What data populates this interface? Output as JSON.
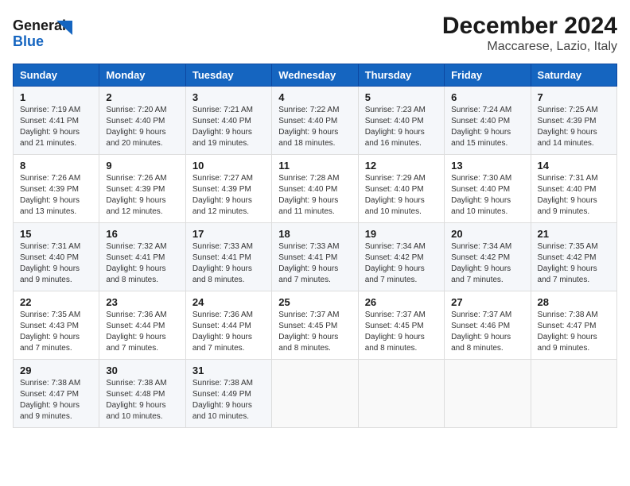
{
  "header": {
    "logo_line1": "General",
    "logo_line2": "Blue",
    "title": "December 2024",
    "subtitle": "Maccarese, Lazio, Italy"
  },
  "days_of_week": [
    "Sunday",
    "Monday",
    "Tuesday",
    "Wednesday",
    "Thursday",
    "Friday",
    "Saturday"
  ],
  "weeks": [
    [
      {
        "day": "1",
        "lines": [
          "Sunrise: 7:19 AM",
          "Sunset: 4:41 PM",
          "Daylight: 9 hours",
          "and 21 minutes."
        ]
      },
      {
        "day": "2",
        "lines": [
          "Sunrise: 7:20 AM",
          "Sunset: 4:40 PM",
          "Daylight: 9 hours",
          "and 20 minutes."
        ]
      },
      {
        "day": "3",
        "lines": [
          "Sunrise: 7:21 AM",
          "Sunset: 4:40 PM",
          "Daylight: 9 hours",
          "and 19 minutes."
        ]
      },
      {
        "day": "4",
        "lines": [
          "Sunrise: 7:22 AM",
          "Sunset: 4:40 PM",
          "Daylight: 9 hours",
          "and 18 minutes."
        ]
      },
      {
        "day": "5",
        "lines": [
          "Sunrise: 7:23 AM",
          "Sunset: 4:40 PM",
          "Daylight: 9 hours",
          "and 16 minutes."
        ]
      },
      {
        "day": "6",
        "lines": [
          "Sunrise: 7:24 AM",
          "Sunset: 4:40 PM",
          "Daylight: 9 hours",
          "and 15 minutes."
        ]
      },
      {
        "day": "7",
        "lines": [
          "Sunrise: 7:25 AM",
          "Sunset: 4:39 PM",
          "Daylight: 9 hours",
          "and 14 minutes."
        ]
      }
    ],
    [
      {
        "day": "8",
        "lines": [
          "Sunrise: 7:26 AM",
          "Sunset: 4:39 PM",
          "Daylight: 9 hours",
          "and 13 minutes."
        ]
      },
      {
        "day": "9",
        "lines": [
          "Sunrise: 7:26 AM",
          "Sunset: 4:39 PM",
          "Daylight: 9 hours",
          "and 12 minutes."
        ]
      },
      {
        "day": "10",
        "lines": [
          "Sunrise: 7:27 AM",
          "Sunset: 4:39 PM",
          "Daylight: 9 hours",
          "and 12 minutes."
        ]
      },
      {
        "day": "11",
        "lines": [
          "Sunrise: 7:28 AM",
          "Sunset: 4:40 PM",
          "Daylight: 9 hours",
          "and 11 minutes."
        ]
      },
      {
        "day": "12",
        "lines": [
          "Sunrise: 7:29 AM",
          "Sunset: 4:40 PM",
          "Daylight: 9 hours",
          "and 10 minutes."
        ]
      },
      {
        "day": "13",
        "lines": [
          "Sunrise: 7:30 AM",
          "Sunset: 4:40 PM",
          "Daylight: 9 hours",
          "and 10 minutes."
        ]
      },
      {
        "day": "14",
        "lines": [
          "Sunrise: 7:31 AM",
          "Sunset: 4:40 PM",
          "Daylight: 9 hours",
          "and 9 minutes."
        ]
      }
    ],
    [
      {
        "day": "15",
        "lines": [
          "Sunrise: 7:31 AM",
          "Sunset: 4:40 PM",
          "Daylight: 9 hours",
          "and 9 minutes."
        ]
      },
      {
        "day": "16",
        "lines": [
          "Sunrise: 7:32 AM",
          "Sunset: 4:41 PM",
          "Daylight: 9 hours",
          "and 8 minutes."
        ]
      },
      {
        "day": "17",
        "lines": [
          "Sunrise: 7:33 AM",
          "Sunset: 4:41 PM",
          "Daylight: 9 hours",
          "and 8 minutes."
        ]
      },
      {
        "day": "18",
        "lines": [
          "Sunrise: 7:33 AM",
          "Sunset: 4:41 PM",
          "Daylight: 9 hours",
          "and 7 minutes."
        ]
      },
      {
        "day": "19",
        "lines": [
          "Sunrise: 7:34 AM",
          "Sunset: 4:42 PM",
          "Daylight: 9 hours",
          "and 7 minutes."
        ]
      },
      {
        "day": "20",
        "lines": [
          "Sunrise: 7:34 AM",
          "Sunset: 4:42 PM",
          "Daylight: 9 hours",
          "and 7 minutes."
        ]
      },
      {
        "day": "21",
        "lines": [
          "Sunrise: 7:35 AM",
          "Sunset: 4:42 PM",
          "Daylight: 9 hours",
          "and 7 minutes."
        ]
      }
    ],
    [
      {
        "day": "22",
        "lines": [
          "Sunrise: 7:35 AM",
          "Sunset: 4:43 PM",
          "Daylight: 9 hours",
          "and 7 minutes."
        ]
      },
      {
        "day": "23",
        "lines": [
          "Sunrise: 7:36 AM",
          "Sunset: 4:44 PM",
          "Daylight: 9 hours",
          "and 7 minutes."
        ]
      },
      {
        "day": "24",
        "lines": [
          "Sunrise: 7:36 AM",
          "Sunset: 4:44 PM",
          "Daylight: 9 hours",
          "and 7 minutes."
        ]
      },
      {
        "day": "25",
        "lines": [
          "Sunrise: 7:37 AM",
          "Sunset: 4:45 PM",
          "Daylight: 9 hours",
          "and 8 minutes."
        ]
      },
      {
        "day": "26",
        "lines": [
          "Sunrise: 7:37 AM",
          "Sunset: 4:45 PM",
          "Daylight: 9 hours",
          "and 8 minutes."
        ]
      },
      {
        "day": "27",
        "lines": [
          "Sunrise: 7:37 AM",
          "Sunset: 4:46 PM",
          "Daylight: 9 hours",
          "and 8 minutes."
        ]
      },
      {
        "day": "28",
        "lines": [
          "Sunrise: 7:38 AM",
          "Sunset: 4:47 PM",
          "Daylight: 9 hours",
          "and 9 minutes."
        ]
      }
    ],
    [
      {
        "day": "29",
        "lines": [
          "Sunrise: 7:38 AM",
          "Sunset: 4:47 PM",
          "Daylight: 9 hours",
          "and 9 minutes."
        ]
      },
      {
        "day": "30",
        "lines": [
          "Sunrise: 7:38 AM",
          "Sunset: 4:48 PM",
          "Daylight: 9 hours",
          "and 10 minutes."
        ]
      },
      {
        "day": "31",
        "lines": [
          "Sunrise: 7:38 AM",
          "Sunset: 4:49 PM",
          "Daylight: 9 hours",
          "and 10 minutes."
        ]
      },
      {
        "day": "",
        "lines": []
      },
      {
        "day": "",
        "lines": []
      },
      {
        "day": "",
        "lines": []
      },
      {
        "day": "",
        "lines": []
      }
    ]
  ]
}
